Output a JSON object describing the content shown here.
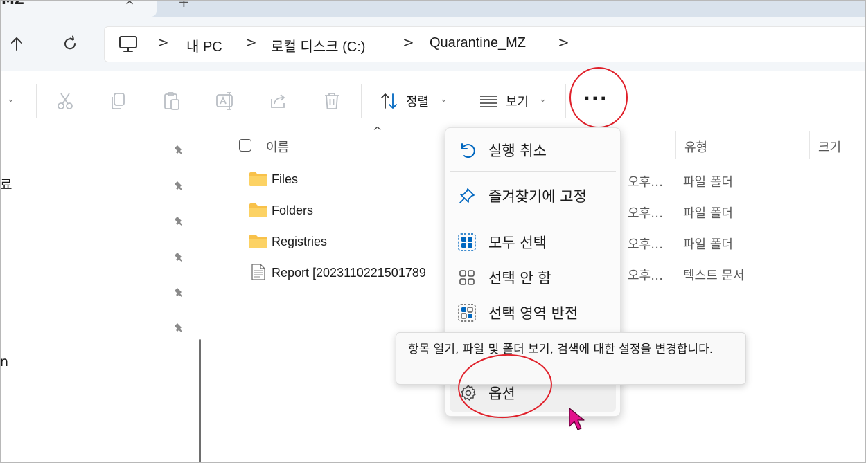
{
  "tab": {
    "title": "MZ",
    "close": "×",
    "add": "+"
  },
  "nav": {
    "up_icon": "arrow-up-icon",
    "refresh_icon": "refresh-icon"
  },
  "breadcrumb": {
    "items": [
      "내 PC",
      "로컬 디스크 (C:)",
      "Quarantine_MZ"
    ],
    "separator": ">"
  },
  "toolbar": {
    "sort_label": "정렬",
    "view_label": "보기",
    "more_label": "···",
    "icons": [
      "cut-icon",
      "copy-icon",
      "paste-icon",
      "rename-icon",
      "share-icon",
      "delete-icon"
    ]
  },
  "sidebar": {
    "partial_labels": [
      "료",
      "n"
    ],
    "pin_count": 6
  },
  "file_list": {
    "columns": {
      "name": "이름",
      "type": "유형",
      "size": "크기"
    },
    "rows": [
      {
        "name": "Files",
        "date": "오후…",
        "type": "파일 폴더",
        "icon": "folder-icon"
      },
      {
        "name": "Folders",
        "date": "오후…",
        "type": "파일 폴더",
        "icon": "folder-icon"
      },
      {
        "name": "Registries",
        "date": "오후…",
        "type": "파일 폴더",
        "icon": "folder-icon"
      },
      {
        "name": "Report [2023110221501789",
        "date": "오후…",
        "type": "텍스트 문서",
        "icon": "text-file-icon"
      }
    ]
  },
  "menu": {
    "undo": "실행 취소",
    "pin_favorites": "즐겨찾기에 고정",
    "select_all": "모두 선택",
    "select_none": "선택 안 함",
    "invert_selection": "선택 영역 반전",
    "options": "옵션"
  },
  "tooltip": {
    "text": "항목 열기, 파일 및 폴더 보기, 검색에 대한 설정을 변경합니다."
  },
  "colors": {
    "accent": "#0067c0",
    "annotation": "#e0202a",
    "folder": "#f8c14a",
    "cursor": "#e3128c"
  }
}
